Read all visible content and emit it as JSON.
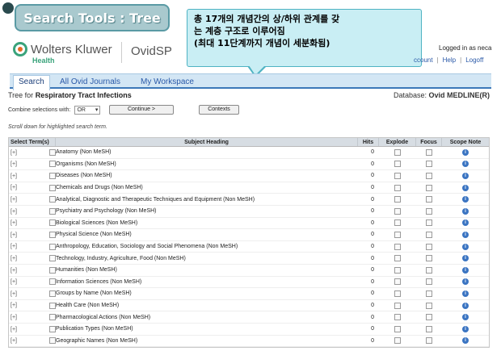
{
  "slide": {
    "title": "Search Tools : Tree",
    "callout_lines": [
      "총 17개의 개념간의 상/하위 관계를 갖",
      "는 계층 구조로 이루어짐",
      "(최대 11단계까지 개념이 세분화됨)"
    ]
  },
  "header": {
    "brand": "Wolters Kluwer",
    "brand_sub": "Health",
    "product": "OvidSP",
    "logged_in": "Logged in as neca",
    "links": [
      "ccount",
      "Help",
      "Logoff"
    ],
    "link_sep": "|"
  },
  "nav": {
    "tabs": [
      "Search",
      "All Ovid Journals",
      "My Workspace"
    ]
  },
  "tree": {
    "prefix": "Tree for",
    "term": "Respiratory Tract Infections",
    "database_label": "Database:",
    "database": "Ovid MEDLINE(R)"
  },
  "controls": {
    "combine_label": "Combine selections with:",
    "combine_value": "OR",
    "continue_label": "Continue >",
    "contexts_label": "Contexts",
    "scroll_note": "Scroll down for highlighted search term."
  },
  "table": {
    "headers": [
      "Select Term(s)",
      "Subject Heading",
      "Hits",
      "Explode",
      "Focus",
      "Scope Note"
    ],
    "expander": "[+]",
    "rows": [
      {
        "heading": "Anatomy (Non MeSH)",
        "hits": "0"
      },
      {
        "heading": "Organisms (Non MeSH)",
        "hits": "0"
      },
      {
        "heading": "Diseases (Non MeSH)",
        "hits": "0"
      },
      {
        "heading": "Chemicals and Drugs (Non MeSH)",
        "hits": "0"
      },
      {
        "heading": "Analytical, Diagnostic and Therapeutic Techniques and Equipment (Non MeSH)",
        "hits": "0"
      },
      {
        "heading": "Psychiatry and Psychology (Non MeSH)",
        "hits": "0"
      },
      {
        "heading": "Biological Sciences (Non MeSH)",
        "hits": "0"
      },
      {
        "heading": "Physical Science (Non MeSH)",
        "hits": "0"
      },
      {
        "heading": "Anthropology, Education, Sociology and Social Phenomena (Non MeSH)",
        "hits": "0"
      },
      {
        "heading": "Technology, Industry, Agriculture, Food (Non MeSH)",
        "hits": "0"
      },
      {
        "heading": "Humanities (Non MeSH)",
        "hits": "0"
      },
      {
        "heading": "Information Sciences (Non MeSH)",
        "hits": "0"
      },
      {
        "heading": "Groups by Name (Non MeSH)",
        "hits": "0"
      },
      {
        "heading": "Health Care (Non MeSH)",
        "hits": "0"
      },
      {
        "heading": "Pharmacological Actions (Non MeSH)",
        "hits": "0"
      },
      {
        "heading": "Publication Types (Non MeSH)",
        "hits": "0"
      },
      {
        "heading": "Geographic Names (Non MeSH)",
        "hits": "0"
      }
    ]
  }
}
